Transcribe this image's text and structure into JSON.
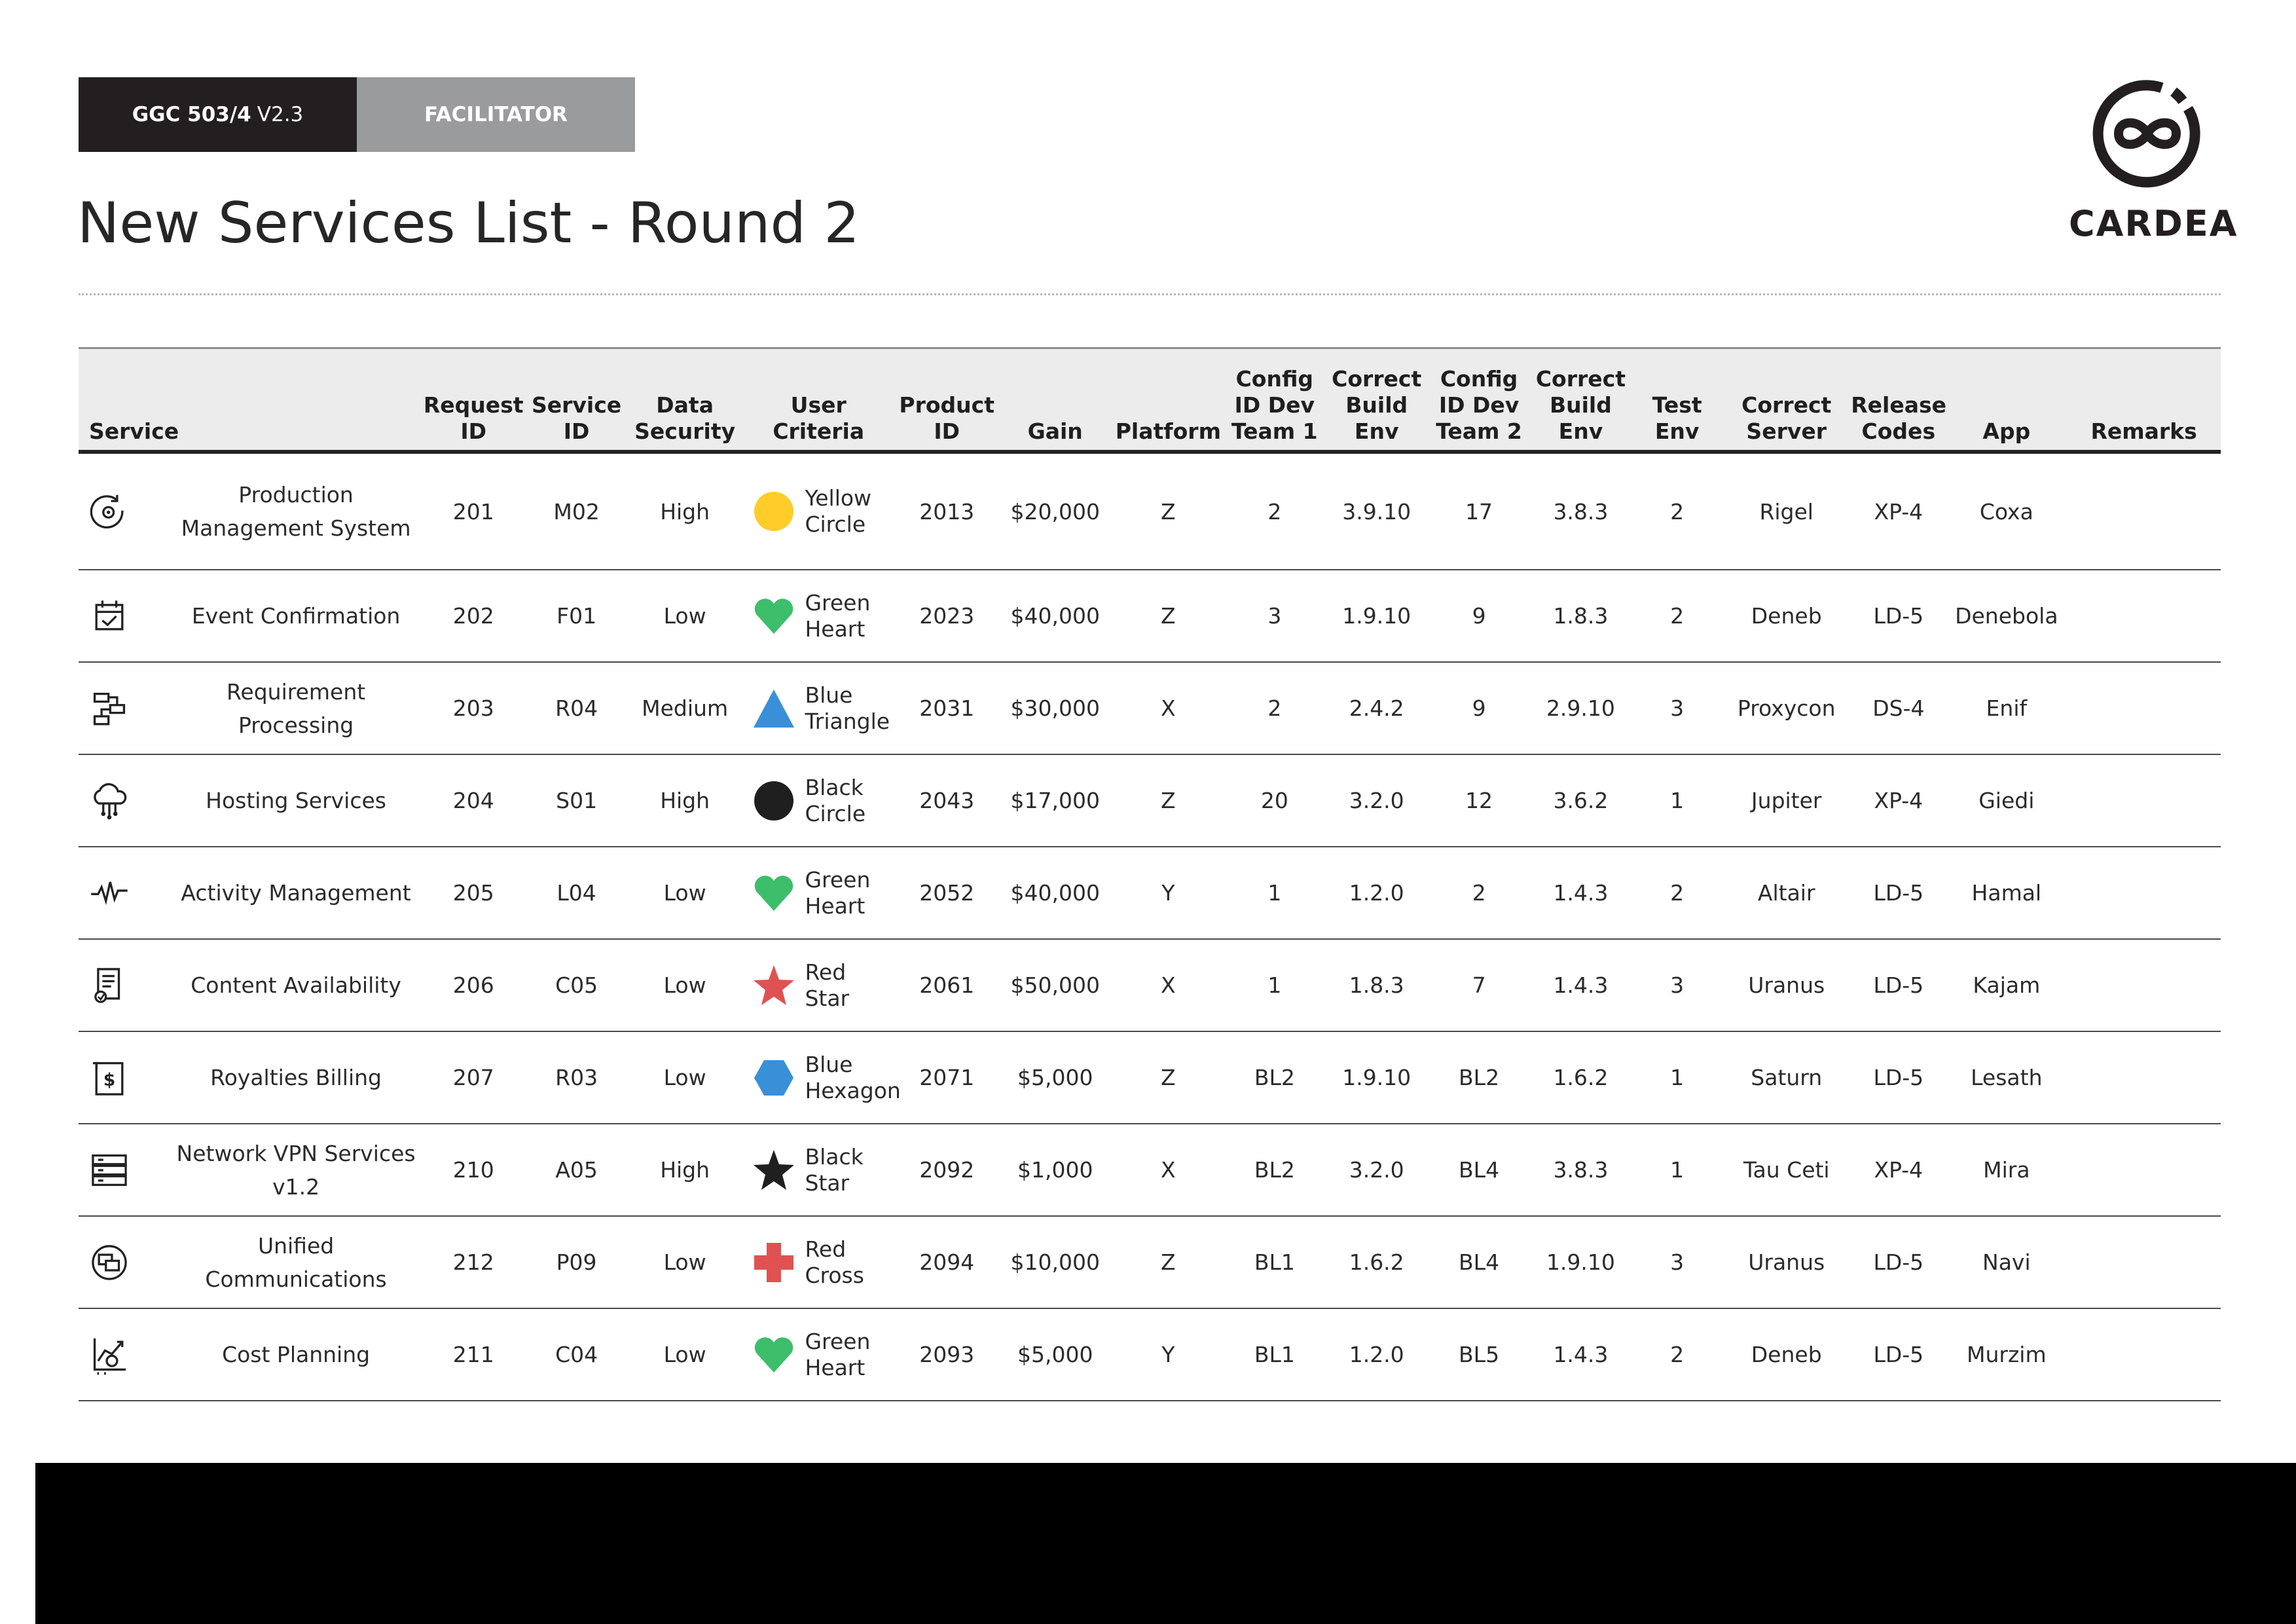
{
  "header": {
    "doc_code": "GGC 503/4",
    "doc_version": "V2.3",
    "role_tab": "FACILITATOR",
    "title": "New Services List - Round 2",
    "logo_text": "CARDEA"
  },
  "table": {
    "columns": {
      "service": "Service",
      "request_id": "Request ID",
      "service_id": "Service ID",
      "data_security": "Data Security",
      "user_criteria": "User Criteria",
      "product_id": "Product ID",
      "gain": "Gain",
      "platform": "Platform",
      "config_team1": "Config ID Dev Team 1",
      "build_env1": "Correct Build Env",
      "config_team2": "Config ID Dev Team 2",
      "build_env2": "Correct Build Env",
      "test_env": "Test Env",
      "server": "Correct Server",
      "release_codes": "Release Codes",
      "app": "App",
      "remarks": "Remarks"
    },
    "rows": [
      {
        "icon": "gear-cycle-icon",
        "service": "Production Management System",
        "request_id": "201",
        "service_id": "M02",
        "data_security": "High",
        "criteria_shape": "circle",
        "criteria_color": "#FFCC29",
        "criteria": "Yellow Circle",
        "product_id": "2013",
        "gain": "$20,000",
        "platform": "Z",
        "config_team1": "2",
        "build_env1": "3.9.10",
        "config_team2": "17",
        "build_env2": "3.8.3",
        "test_env": "2",
        "server": "Rigel",
        "release_codes": "XP-4",
        "app": "Coxa",
        "remarks": ""
      },
      {
        "icon": "calendar-check-icon",
        "service": "Event Confirmation",
        "request_id": "202",
        "service_id": "F01",
        "data_security": "Low",
        "criteria_shape": "heart",
        "criteria_color": "#3DBE6A",
        "criteria": "Green Heart",
        "product_id": "2023",
        "gain": "$40,000",
        "platform": "Z",
        "config_team1": "3",
        "build_env1": "1.9.10",
        "config_team2": "9",
        "build_env2": "1.8.3",
        "test_env": "2",
        "server": "Deneb",
        "release_codes": "LD-5",
        "app": "Denebola",
        "remarks": ""
      },
      {
        "icon": "process-flow-icon",
        "service": "Requirement Processing",
        "request_id": "203",
        "service_id": "R04",
        "data_security": "Medium",
        "criteria_shape": "triangle",
        "criteria_color": "#3A8FD9",
        "criteria": "Blue Triangle",
        "product_id": "2031",
        "gain": "$30,000",
        "platform": "X",
        "config_team1": "2",
        "build_env1": "2.4.2",
        "config_team2": "9",
        "build_env2": "2.9.10",
        "test_env": "3",
        "server": "Proxycon",
        "release_codes": "DS-4",
        "app": "Enif",
        "remarks": ""
      },
      {
        "icon": "cloud-network-icon",
        "service": "Hosting Services",
        "request_id": "204",
        "service_id": "S01",
        "data_security": "High",
        "criteria_shape": "circle",
        "criteria_color": "#1F1F1F",
        "criteria": "Black Circle",
        "product_id": "2043",
        "gain": "$17,000",
        "platform": "Z",
        "config_team1": "20",
        "build_env1": "3.2.0",
        "config_team2": "12",
        "build_env2": "3.6.2",
        "test_env": "1",
        "server": "Jupiter",
        "release_codes": "XP-4",
        "app": "Giedi",
        "remarks": ""
      },
      {
        "icon": "pulse-icon",
        "service": "Activity Management",
        "request_id": "205",
        "service_id": "L04",
        "data_security": "Low",
        "criteria_shape": "heart",
        "criteria_color": "#3DBE6A",
        "criteria": "Green Heart",
        "product_id": "2052",
        "gain": "$40,000",
        "platform": "Y",
        "config_team1": "1",
        "build_env1": "1.2.0",
        "config_team2": "2",
        "build_env2": "1.4.3",
        "test_env": "2",
        "server": "Altair",
        "release_codes": "LD-5",
        "app": "Hamal",
        "remarks": ""
      },
      {
        "icon": "document-check-icon",
        "service": "Content Availability",
        "request_id": "206",
        "service_id": "C05",
        "data_security": "Low",
        "criteria_shape": "star",
        "criteria_color": "#E05252",
        "criteria": "Red Star",
        "product_id": "2061",
        "gain": "$50,000",
        "platform": "X",
        "config_team1": "1",
        "build_env1": "1.8.3",
        "config_team2": "7",
        "build_env2": "1.4.3",
        "test_env": "3",
        "server": "Uranus",
        "release_codes": "LD-5",
        "app": "Kajam",
        "remarks": ""
      },
      {
        "icon": "dollar-bill-icon",
        "service": "Royalties Billing",
        "request_id": "207",
        "service_id": "R03",
        "data_security": "Low",
        "criteria_shape": "hexagon",
        "criteria_color": "#3A8FD9",
        "criteria": "Blue Hexagon",
        "product_id": "2071",
        "gain": "$5,000",
        "platform": "Z",
        "config_team1": "BL2",
        "build_env1": "1.9.10",
        "config_team2": "BL2",
        "build_env2": "1.6.2",
        "test_env": "1",
        "server": "Saturn",
        "release_codes": "LD-5",
        "app": "Lesath",
        "remarks": ""
      },
      {
        "icon": "server-stack-icon",
        "service": "Network VPN Services v1.2",
        "request_id": "210",
        "service_id": "A05",
        "data_security": "High",
        "criteria_shape": "star",
        "criteria_color": "#1F1F1F",
        "criteria": "Black Star",
        "product_id": "2092",
        "gain": "$1,000",
        "platform": "X",
        "config_team1": "BL2",
        "build_env1": "3.2.0",
        "config_team2": "BL4",
        "build_env2": "3.8.3",
        "test_env": "1",
        "server": "Tau Ceti",
        "release_codes": "XP-4",
        "app": "Mira",
        "remarks": ""
      },
      {
        "icon": "chat-bubbles-icon",
        "service": "Unified Communications",
        "request_id": "212",
        "service_id": "P09",
        "data_security": "Low",
        "criteria_shape": "cross",
        "criteria_color": "#E05252",
        "criteria": "Red Cross",
        "product_id": "2094",
        "gain": "$10,000",
        "platform": "Z",
        "config_team1": "BL1",
        "build_env1": "1.6.2",
        "config_team2": "BL4",
        "build_env2": "1.9.10",
        "test_env": "3",
        "server": "Uranus",
        "release_codes": "LD-5",
        "app": "Navi",
        "remarks": ""
      },
      {
        "icon": "chart-money-icon",
        "service": "Cost Planning",
        "request_id": "211",
        "service_id": "C04",
        "data_security": "Low",
        "criteria_shape": "heart",
        "criteria_color": "#3DBE6A",
        "criteria": "Green Heart",
        "product_id": "2093",
        "gain": "$5,000",
        "platform": "Y",
        "config_team1": "BL1",
        "build_env1": "1.2.0",
        "config_team2": "BL5",
        "build_env2": "1.4.3",
        "test_env": "2",
        "server": "Deneb",
        "release_codes": "LD-5",
        "app": "Murzim",
        "remarks": ""
      }
    ]
  }
}
